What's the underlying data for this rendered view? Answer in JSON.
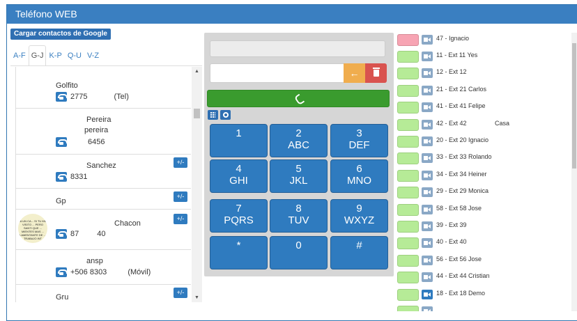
{
  "window": {
    "title": "Teléfono WEB"
  },
  "contacts_panel": {
    "google_button": "Cargar contactos de Google",
    "tabs": [
      {
        "label": "A-F",
        "active": false
      },
      {
        "label": "G-J",
        "active": true
      },
      {
        "label": "K-P",
        "active": false
      },
      {
        "label": "Q-U",
        "active": false
      },
      {
        "label": "V-Z",
        "active": false
      }
    ],
    "contacts": [
      {
        "name": "Golfito",
        "number": "2775",
        "type": "(Tel)"
      },
      {
        "name": "Pereira",
        "subname": "pereira",
        "number": "6456"
      },
      {
        "name": "Sanchez",
        "number": "8331",
        "button": "+/-"
      },
      {
        "name": "Gp",
        "button": "+/-"
      },
      {
        "name": "Chacon",
        "number": "87",
        "number2": "40",
        "button": "+/-",
        "avatar_text": "LA UN CA... SI TU MIA VISITO ... PERO SANTI QUE ... MIENTES MAS ... LAMENTANTE DE ... TRABAJO INT"
      },
      {
        "name": "ansp",
        "number": "+506 8303",
        "type": "(Móvil)"
      },
      {
        "name": "Gru",
        "button": "+/-"
      }
    ]
  },
  "dialer": {
    "display_value": "",
    "input_value": "",
    "keys": [
      {
        "digit": "1",
        "letters": ""
      },
      {
        "digit": "2",
        "letters": "ABC"
      },
      {
        "digit": "3",
        "letters": "DEF"
      },
      {
        "digit": "4",
        "letters": "GHI"
      },
      {
        "digit": "5",
        "letters": "JKL"
      },
      {
        "digit": "6",
        "letters": "MNO"
      },
      {
        "digit": "7",
        "letters": "PQRS"
      },
      {
        "digit": "8",
        "letters": "TUV"
      },
      {
        "digit": "9",
        "letters": "WXYZ"
      },
      {
        "digit": "*",
        "letters": ""
      },
      {
        "digit": "0",
        "letters": ""
      },
      {
        "digit": "#",
        "letters": ""
      }
    ],
    "colors": {
      "call": "#3a9b2e",
      "backspace": "#f0ad4e",
      "delete": "#d9534f",
      "key": "#2f7bbf"
    }
  },
  "extensions": [
    {
      "label": "47 - Ignacio",
      "status": "pink",
      "video": "gray"
    },
    {
      "label": "11 - Ext 11 Yes",
      "status": "green",
      "video": "gray"
    },
    {
      "label": "12 - Ext 12",
      "status": "green",
      "video": "gray"
    },
    {
      "label": "21 - Ext 21 Carlos",
      "status": "green",
      "video": "gray"
    },
    {
      "label": "41 - Ext 41 Felipe",
      "status": "green",
      "video": "gray"
    },
    {
      "label": "42 - Ext 42",
      "extra": "Casa",
      "status": "green",
      "video": "gray"
    },
    {
      "label": "20 - Ext 20 Ignacio",
      "status": "green",
      "video": "gray"
    },
    {
      "label": "33 - Ext 33 Rolando",
      "status": "green",
      "video": "gray"
    },
    {
      "label": "34 - Ext 34 Heiner",
      "status": "green",
      "video": "gray"
    },
    {
      "label": "29 - Ext 29 Monica",
      "status": "green",
      "video": "gray"
    },
    {
      "label": "58 - Ext 58 Jose",
      "status": "green",
      "video": "gray"
    },
    {
      "label": "39 - Ext 39",
      "status": "green",
      "video": "gray"
    },
    {
      "label": "40 - Ext 40",
      "status": "green",
      "video": "gray"
    },
    {
      "label": "56 - Ext 56 Jose",
      "status": "green",
      "video": "gray"
    },
    {
      "label": "44 - Ext 44 Cristian",
      "status": "green",
      "video": "gray"
    },
    {
      "label": "18 - Ext 18 Demo",
      "status": "green",
      "video": "blue"
    }
  ]
}
